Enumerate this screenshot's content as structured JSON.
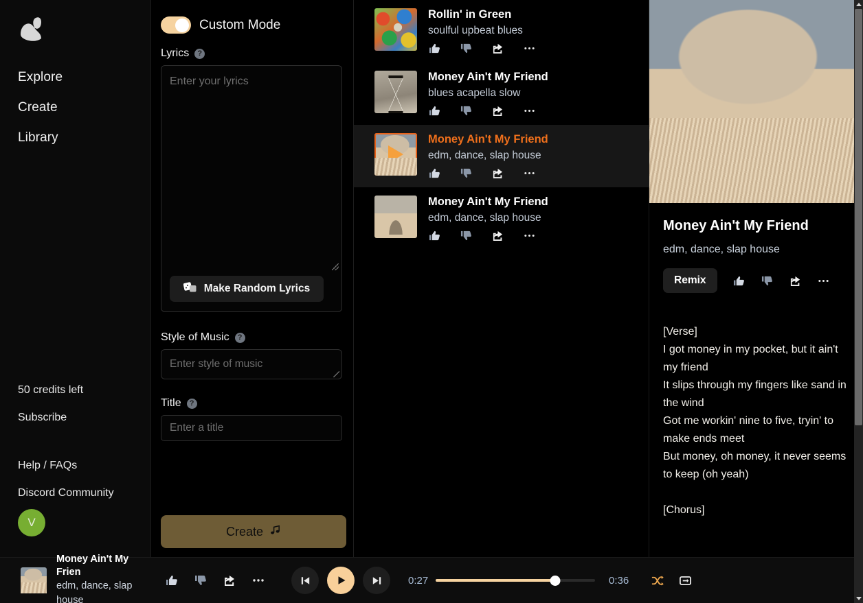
{
  "sidebar": {
    "logo_name": "wave-logo",
    "nav": [
      {
        "label": "Explore"
      },
      {
        "label": "Create"
      },
      {
        "label": "Library"
      }
    ],
    "credits": "50 credits left",
    "subscribe": "Subscribe",
    "help": "Help / FAQs",
    "discord": "Discord Community",
    "avatar_initial": "V",
    "avatar_color": "#77ae32"
  },
  "create_panel": {
    "custom_mode_label": "Custom Mode",
    "custom_mode_on": true,
    "toggle_color": "#f6d3a0",
    "lyrics_label": "Lyrics",
    "lyrics_placeholder": "Enter your lyrics",
    "lyrics_value": "",
    "random_lyrics_label": "Make Random Lyrics",
    "style_label": "Style of Music",
    "style_placeholder": "Enter style of music",
    "style_value": "",
    "title_label": "Title",
    "title_placeholder": "Enter a title",
    "title_value": "",
    "create_label": "Create",
    "create_color": "#6e5c36",
    "help_icon_char": "?"
  },
  "song_list": {
    "items": [
      {
        "title": "Rollin' in Green",
        "tags": "soulful upbeat blues",
        "art": "art-green",
        "active": false
      },
      {
        "title": "Money Ain't My Friend",
        "tags": "blues acapella slow",
        "art": "art-hourglass",
        "active": false
      },
      {
        "title": "Money Ain't My Friend",
        "tags": "edm, dance, slap house",
        "art": "art-tornado",
        "active": true
      },
      {
        "title": "Money Ain't My Friend",
        "tags": "edm, dance, slap house",
        "art": "art-hand",
        "active": false
      }
    ],
    "active_color": "#f0701c"
  },
  "detail": {
    "title": "Money Ain't My Friend",
    "tags": "edm, dance, slap house",
    "remix_label": "Remix",
    "lyrics": "[Verse]\nI got money in my pocket, but it ain't my friend\nIt slips through my fingers like sand in the wind\nGot me workin' nine to five, tryin' to make ends meet\nBut money, oh money, it never seems to keep (oh yeah)\n\n[Chorus]"
  },
  "player": {
    "title": "Money Ain't My Frien",
    "tags": "edm, dance, slap house",
    "current_time": "0:27",
    "total_time": "0:36",
    "progress_percent": 75,
    "is_playing": true,
    "shuffle_active": true,
    "repeat_active": false,
    "accent_color": "#f8d09a"
  }
}
